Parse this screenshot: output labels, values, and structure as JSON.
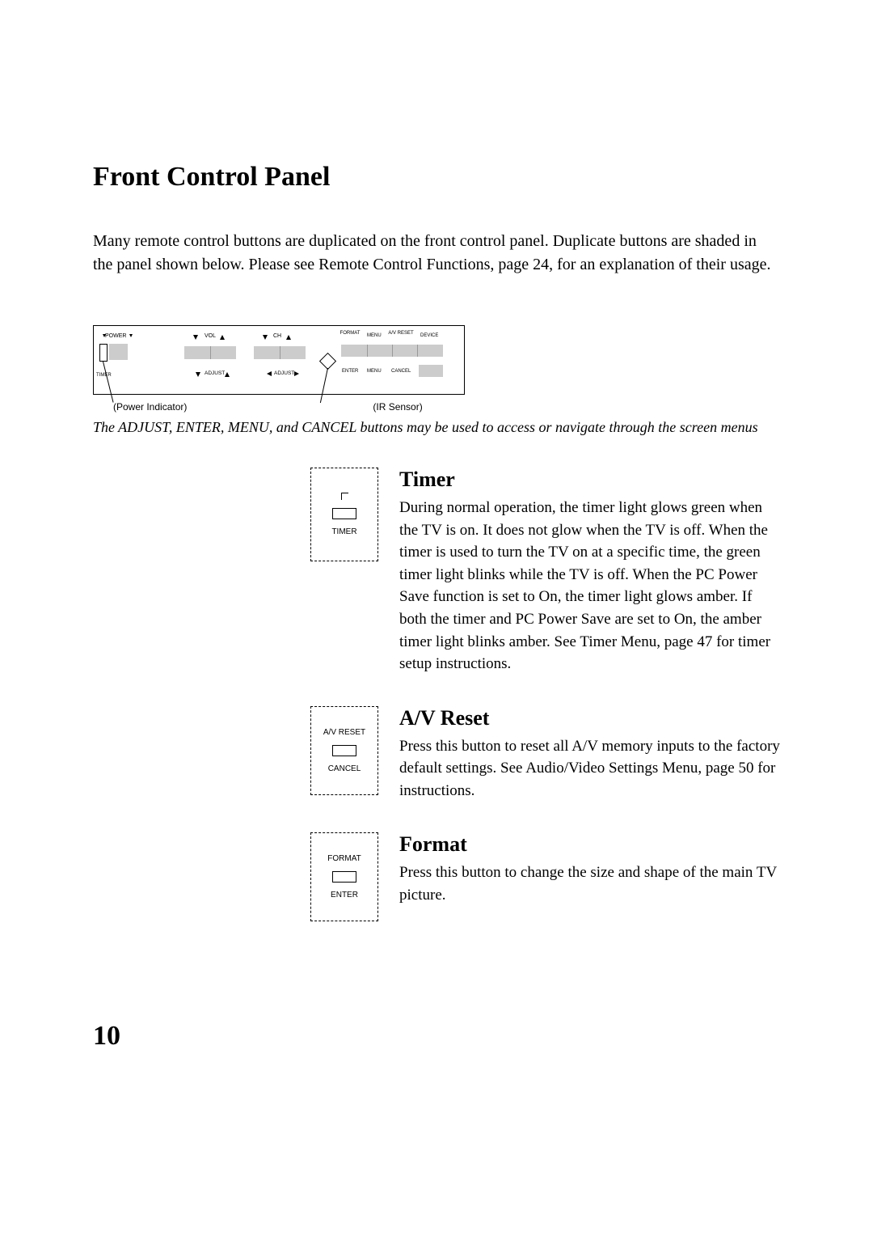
{
  "title": "Front Control Panel",
  "intro": "Many remote control buttons are duplicated on the front control panel.  Duplicate buttons are shaded in the panel shown below.  Please see Remote Control Functions, page 24, for an explanation of their usage.",
  "panel": {
    "power": "POWER",
    "timer_lower": "TIMER",
    "vol": "VOL",
    "ch": "CH",
    "adjust_v": "ADJUST",
    "adjust_h": "ADJUST",
    "format": "FORMAT",
    "menu": "MENU",
    "av_reset": "A/V RESET",
    "device": "DEVICE",
    "enter": "ENTER",
    "menu2": "MENU",
    "cancel": "CANCEL",
    "below_left": "(Power Indicator)",
    "below_right": "(IR Sensor)"
  },
  "caption": "The ADJUST, ENTER, MENU, and CANCEL buttons may be used to access or navigate through the screen menus",
  "timer": {
    "callout": "TIMER",
    "heading": "Timer",
    "text": "During normal operation, the timer light glows green when the TV is on.  It does not glow when the TV is off.  When the timer is used to turn the TV on at a specific time, the green timer light blinks while the TV is off.  When the PC Power Save function is set to On, the timer light glows amber.  If both the timer and PC Power Save are set to On, the amber timer light blinks amber.  See Timer Menu, page 47 for timer setup instructions."
  },
  "avreset": {
    "callout_top": "A/V RESET",
    "callout_bottom": "CANCEL",
    "heading": "A/V Reset",
    "text": "Press this button to reset all A/V memory inputs to the factory default settings.  See Audio/Video Settings Menu, page 50 for instructions."
  },
  "format": {
    "callout_top": "FORMAT",
    "callout_bottom": "ENTER",
    "heading": "Format",
    "text": "Press this button to change the size and shape of the main TV picture."
  },
  "page_number": "10"
}
